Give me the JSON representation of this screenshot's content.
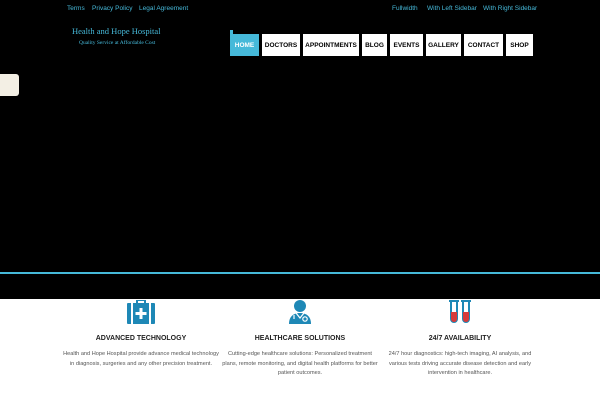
{
  "topbar": {
    "left_links": [
      "Terms",
      "Privacy Policy",
      "Legal Agreement"
    ],
    "right_links": [
      "Fullwidth",
      "With Left Sidebar",
      "With Right Sidebar"
    ]
  },
  "brand": {
    "title": "Health and Hope Hospital",
    "tagline": "Quality Service at Affordable Cost"
  },
  "nav": {
    "items": [
      "HOME",
      "DOCTORS",
      "APPOINTMENTS",
      "BLOG",
      "EVENTS",
      "GALLERY",
      "CONTACT",
      "SHOP"
    ],
    "active": "HOME"
  },
  "features": [
    {
      "icon": "medical-kit-icon",
      "title": "ADVANCED TECHNOLOGY",
      "text": "Health and Hope Hospital provide advance medical technology in diagnosis, surgeries and any other precision treatment."
    },
    {
      "icon": "doctor-icon",
      "title": "HEALTHCARE SOLUTIONS",
      "text": "Cutting-edge healthcare solutions: Personalized treatment plans, remote monitoring, and digital health platforms for better patient outcomes."
    },
    {
      "icon": "test-tubes-icon",
      "title": "24/7 AVAILABILITY",
      "text": "24/7 hour diagnostics: high-tech imaging, AI analysis, and various tests driving accurate disease detection and early intervention in healthcare."
    }
  ],
  "colors": {
    "accent": "#46b9d9",
    "background_dark": "#000000",
    "nav_bg": "#ffffff"
  }
}
